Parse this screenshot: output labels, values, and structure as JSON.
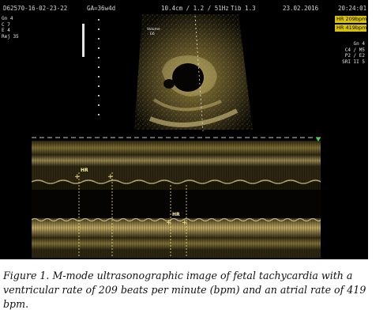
{
  "header": {
    "id": "D62570-16-02-23-22",
    "ga": "GA=36w4d",
    "probe": "10.4cm / 1.2 / 51Hz",
    "tib": "Tib 1.3",
    "date": "23.02.2016",
    "time": "20:24:01"
  },
  "left_params": [
    "Gn  4",
    "C  7",
    "E  4",
    "Rej  35"
  ],
  "hr_labels": {
    "ventricular": "HR  209bpm",
    "atrial": "HR  419bpm"
  },
  "right_params": [
    "Gn  4",
    "C4 / M5",
    "P2 / E2",
    "SRI II 5"
  ],
  "bmode_label": [
    "Volume",
    "E6"
  ],
  "mmode": {
    "marker_1": "HR",
    "marker_2": "HR"
  },
  "caption": {
    "label": "Figure 1.",
    "text": " M-mode ultrasonographic image of fetal tachycardia with a ventricular rate of 209 beats per minute (bpm) and an atrial rate of 419 bpm."
  },
  "colors": {
    "accent_yellow": "#d9c300",
    "background": "#000000"
  }
}
